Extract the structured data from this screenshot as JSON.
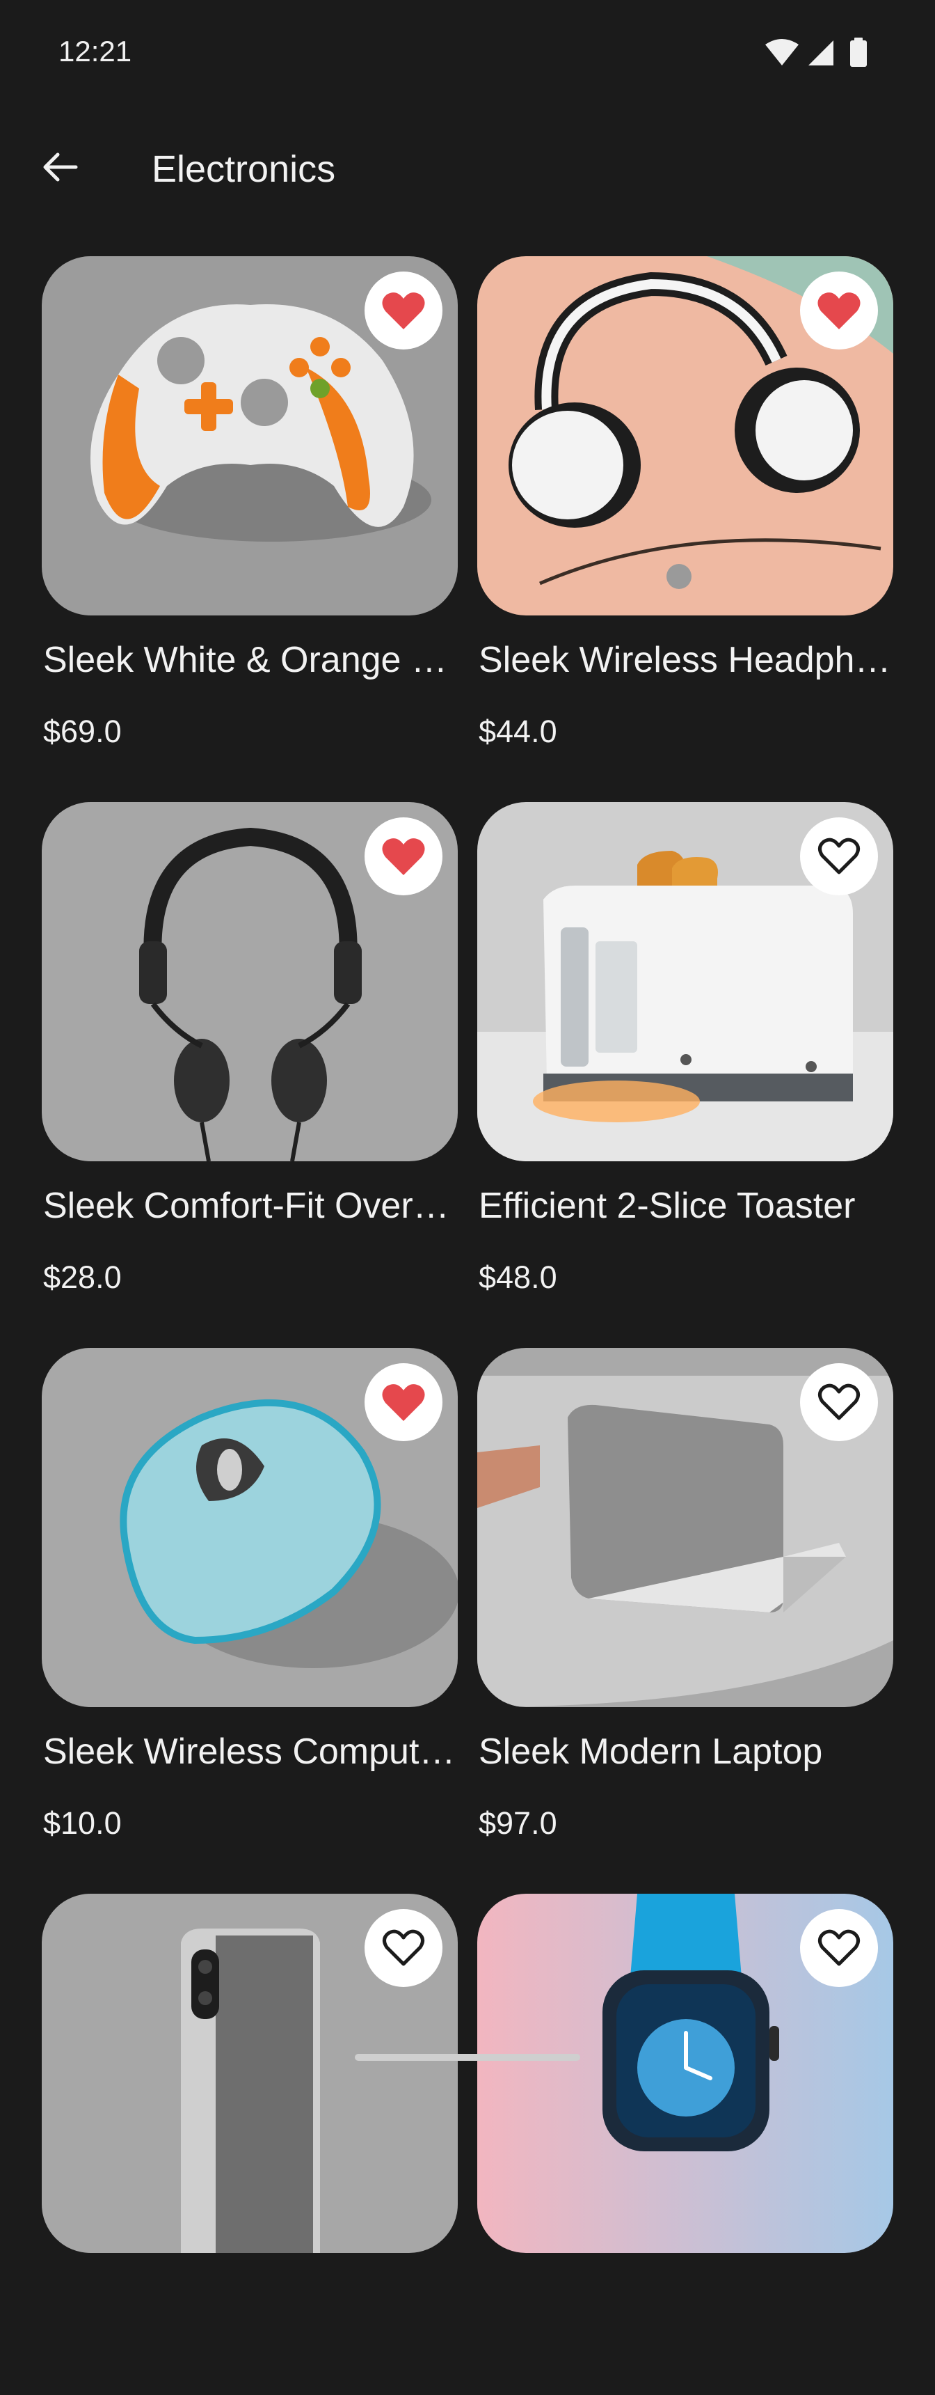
{
  "status_bar": {
    "time": "12:21",
    "icons": [
      "wifi-icon",
      "cellular-signal-icon",
      "battery-icon"
    ]
  },
  "app_bar": {
    "back_icon": "arrow-back-icon",
    "title": "Electronics"
  },
  "colors": {
    "background": "#1b1b1b",
    "favorite_filled": "#e5484d",
    "favorite_button_bg": "#ffffff",
    "text": "#f2f2f2"
  },
  "products": [
    {
      "name": "Sleek White & Orange Wireless Controller",
      "price": "$69.0",
      "favorited": true,
      "image": "game-controller-image"
    },
    {
      "name": "Sleek Wireless Headphones",
      "price": "$44.0",
      "favorited": true,
      "image": "headphones-image"
    },
    {
      "name": "Sleek Comfort-Fit Over-Ear Headphones",
      "price": "$28.0",
      "favorited": true,
      "image": "wired-headphones-image"
    },
    {
      "name": "Efficient 2-Slice Toaster",
      "price": "$48.0",
      "favorited": false,
      "image": "toaster-image"
    },
    {
      "name": "Sleek Wireless Computer Mouse",
      "price": "$10.0",
      "favorited": true,
      "image": "computer-mouse-image"
    },
    {
      "name": "Sleek Modern Laptop",
      "price": "$97.0",
      "favorited": false,
      "image": "laptop-image"
    },
    {
      "name": "",
      "price": "",
      "favorited": false,
      "image": "smartphone-image"
    },
    {
      "name": "",
      "price": "",
      "favorited": false,
      "image": "smartwatch-image"
    }
  ]
}
